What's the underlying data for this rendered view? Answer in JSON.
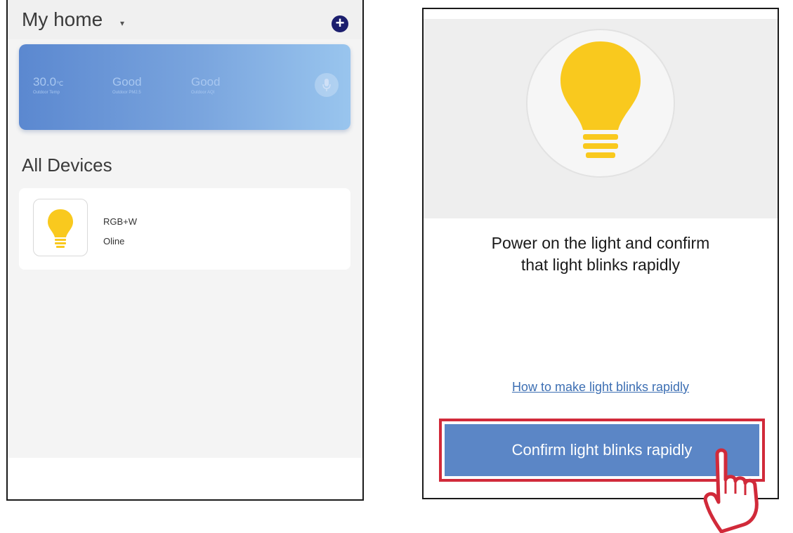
{
  "left_screen": {
    "header": {
      "title": "My home",
      "caret": "▾",
      "add_icon": "plus-circle-icon"
    },
    "weather": [
      {
        "value": "30.0",
        "unit": "℃",
        "label": "Outdoor Temp"
      },
      {
        "value": "Good",
        "unit": "",
        "label": "Outdoor PM2.5"
      },
      {
        "value": "Good",
        "unit": "",
        "label": "Outdoor AQI"
      }
    ],
    "mic_icon": "microphone-icon",
    "devices": {
      "title": "All Devices",
      "items": [
        {
          "name": "RGB+W",
          "status": "Oline",
          "icon": "light-bulb-icon"
        }
      ]
    }
  },
  "right_screen": {
    "hero_icon": "light-bulb-icon",
    "instruction_line1": "Power on the light and confirm",
    "instruction_line2": "that light blinks rapidly",
    "help_link": "How to make light blinks rapidly",
    "confirm_button": "Confirm light blinks rapidly",
    "pointer_icon": "pointing-hand-icon"
  },
  "colors": {
    "accent_blue": "#5b86c6",
    "highlight_red": "#d12a3a",
    "bulb_yellow": "#f9c91e",
    "link_blue": "#3d6fb3"
  }
}
